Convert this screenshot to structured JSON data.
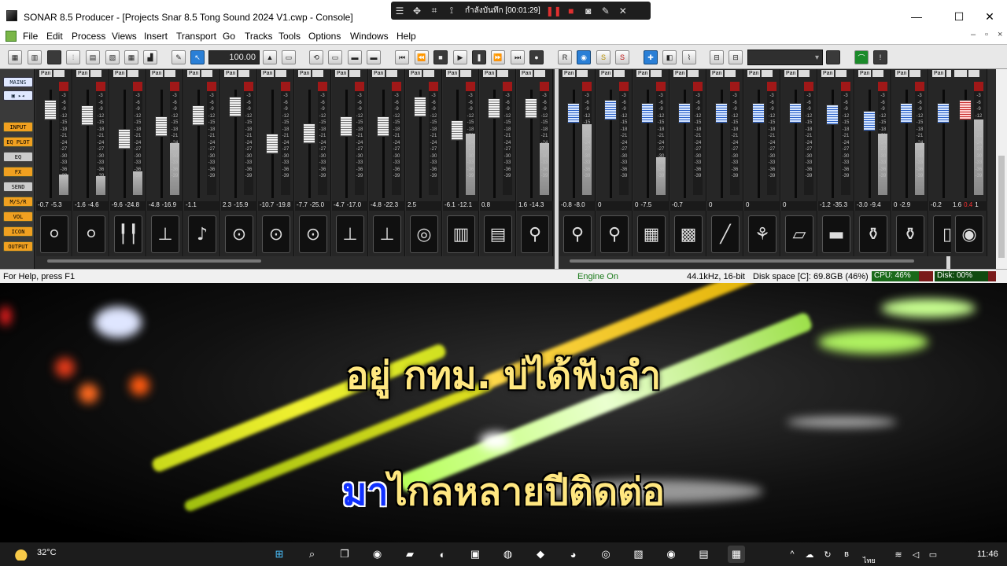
{
  "window": {
    "title": "SONAR 8.5 Producer - [Projects Snar 8.5 Tong Sound 2024 V1.cwp - Console]",
    "minimize": "—",
    "maximize": "☐",
    "close": "✕"
  },
  "recorder": {
    "status": "กำลังบันทึก [00:01:29]",
    "icons": [
      "menu-icon",
      "move-icon",
      "region-icon",
      "crop-icon",
      "pause-icon",
      "stop-icon",
      "camera-icon",
      "pen-icon",
      "close-icon"
    ]
  },
  "menu": {
    "items": [
      "File",
      "Edit",
      "Process",
      "Views",
      "Insert",
      "Transport",
      "Go",
      "Tracks",
      "Tools",
      "Options",
      "Windows",
      "Help"
    ],
    "doc_min": "–",
    "doc_restore": "▫",
    "doc_close": "×"
  },
  "toolbar": {
    "tempo": "100.00",
    "dropdown_arrow": "▾",
    "record_label": "R",
    "solo_label": "S",
    "mute_label": "S"
  },
  "left_panel": {
    "buttons": [
      "MAINS",
      "INPUT",
      "EQ PLOT",
      "EQ",
      "FX",
      "SEND",
      "M/S/R",
      "VOL",
      "ICON",
      "OUTPUT"
    ]
  },
  "strips": [
    {
      "pan": "Pan",
      "vals": [
        "-0.7",
        "-5.3"
      ],
      "icon": "⚪",
      "icon_name": "bass-drum-icon",
      "fader": 0.12,
      "level": 0.22,
      "color": "gray"
    },
    {
      "pan": "Pan",
      "vals": [
        "-1.6",
        "-4.6"
      ],
      "icon": "⚪",
      "icon_name": "drum-icon",
      "fader": 0.18,
      "level": 0.2,
      "color": "gray"
    },
    {
      "pan": "Pan",
      "vals": [
        "-9.6",
        "-24.8"
      ],
      "icon": "╿╿",
      "icon_name": "drumsticks-icon",
      "fader": 0.45,
      "level": 0.25,
      "color": "gray"
    },
    {
      "pan": "Pan",
      "vals": [
        "-4.8",
        "-16.9"
      ],
      "icon": "⊥",
      "icon_name": "hihat-icon",
      "fader": 0.3,
      "level": 0.55,
      "color": "gray"
    },
    {
      "pan": "Pan",
      "vals": [
        "-1.1",
        ""
      ],
      "icon": "♪",
      "icon_name": "microphone-icon",
      "fader": 0.18,
      "level": 0.0,
      "color": "gray"
    },
    {
      "pan": "Pan",
      "vals": [
        "2.3",
        "-15.9"
      ],
      "icon": "⊙",
      "icon_name": "snare-icon",
      "fader": 0.08,
      "level": 0.0,
      "color": "gray"
    },
    {
      "pan": "Pan",
      "vals": [
        "-10.7",
        "-19.8"
      ],
      "icon": "⊙",
      "icon_name": "snare-icon",
      "fader": 0.5,
      "level": 0.0,
      "color": "gray"
    },
    {
      "pan": "Pan",
      "vals": [
        "-7.7",
        "-25.0"
      ],
      "icon": "⊙",
      "icon_name": "snare-icon",
      "fader": 0.38,
      "level": 0.0,
      "color": "gray"
    },
    {
      "pan": "Pan",
      "vals": [
        "-4.7",
        "-17.0"
      ],
      "icon": "⊥",
      "icon_name": "cymbal-icon",
      "fader": 0.3,
      "level": 0.0,
      "color": "gray"
    },
    {
      "pan": "Pan",
      "vals": [
        "-4.8",
        "-22.3"
      ],
      "icon": "⊥",
      "icon_name": "cymbal-icon",
      "fader": 0.3,
      "level": 0.0,
      "color": "gray"
    },
    {
      "pan": "Pan",
      "vals": [
        "2.5",
        ""
      ],
      "icon": "◎",
      "icon_name": "gong-icon",
      "fader": 0.08,
      "level": 0.0,
      "color": "gray"
    },
    {
      "pan": "Pan",
      "vals": [
        "-6.1",
        "-12.1"
      ],
      "icon": "▥",
      "icon_name": "bongo-icon",
      "fader": 0.35,
      "level": 0.65,
      "color": "gray"
    },
    {
      "pan": "Pan",
      "vals": [
        "0.8",
        ""
      ],
      "icon": "▤",
      "icon_name": "accordion-icon",
      "fader": 0.1,
      "level": 0.0,
      "color": "gray"
    },
    {
      "pan": "Pan",
      "vals": [
        "1.6",
        "-14.3"
      ],
      "icon": "⚲",
      "icon_name": "guitar-icon",
      "fader": 0.1,
      "level": 0.55,
      "color": "gray"
    },
    {
      "pan": "Pan",
      "vals": [
        "-0.8",
        "-8.0"
      ],
      "icon": "⚲",
      "icon_name": "electric-guitar-icon",
      "fader": 0.15,
      "level": 0.75,
      "color": "blue"
    },
    {
      "pan": "Pan",
      "vals": [
        "0",
        ""
      ],
      "icon": "⚲",
      "icon_name": "bass-guitar-icon",
      "fader": 0.12,
      "level": 0.0,
      "color": "blue"
    },
    {
      "pan": "Pan",
      "vals": [
        "0",
        "-7.5"
      ],
      "icon": "▦",
      "icon_name": "keyboard-icon",
      "fader": 0.15,
      "level": 0.4,
      "color": "blue"
    },
    {
      "pan": "Pan",
      "vals": [
        "-0.7",
        ""
      ],
      "icon": "▩",
      "icon_name": "piano-player-icon",
      "fader": 0.15,
      "level": 0.0,
      "color": "blue"
    },
    {
      "pan": "Pan",
      "vals": [
        "0",
        ""
      ],
      "icon": "╱",
      "icon_name": "flute-icon",
      "fader": 0.15,
      "level": 0.0,
      "color": "blue"
    },
    {
      "pan": "Pan",
      "vals": [
        "0",
        ""
      ],
      "icon": "⚘",
      "icon_name": "banjo-icon",
      "fader": 0.15,
      "level": 0.0,
      "color": "blue"
    },
    {
      "pan": "Pan",
      "vals": [
        "0",
        ""
      ],
      "icon": "▱",
      "icon_name": "grand-piano-icon",
      "fader": 0.15,
      "level": 0.0,
      "color": "blue"
    },
    {
      "pan": "Pan",
      "vals": [
        "-1.2",
        "-35.3"
      ],
      "icon": "▬",
      "icon_name": "synth-icon",
      "fader": 0.17,
      "level": 0.0,
      "color": "blue"
    },
    {
      "pan": "Pan",
      "vals": [
        "-3.0",
        "-9.4"
      ],
      "icon": "⚱",
      "icon_name": "drum-kit-icon",
      "fader": 0.24,
      "level": 0.65,
      "color": "blue"
    },
    {
      "pan": "Pan",
      "vals": [
        "0",
        "-2.9"
      ],
      "icon": "⚱",
      "icon_name": "drum-kit-icon",
      "fader": 0.15,
      "level": 0.55,
      "color": "blue"
    },
    {
      "pan": "Pan",
      "vals": [
        "-0.2",
        ""
      ],
      "icon": "▯",
      "icon_name": "instrument-icon",
      "fader": 0.15,
      "level": 0.0,
      "color": "blue"
    }
  ],
  "master": {
    "vals": [
      "1.6",
      "0.4",
      "1"
    ],
    "icon": "◉",
    "icon_name": "speaker-icon",
    "fader": 0.12,
    "level": 0.8
  },
  "status": {
    "help": "For Help, press F1",
    "engine": "Engine On",
    "format": "44.1kHz, 16-bit",
    "disk_space": "Disk space [C]: 69.8GB (46%)",
    "cpu": "CPU: 46%",
    "disk": "Disk: 00%"
  },
  "lyrics": {
    "line1": "อยู่ กทม. บ่ได้ฟังลำ",
    "line2_sung": "มา",
    "line2_rest": "ไกลหลายปีติดต่อ"
  },
  "taskbar": {
    "temp": "32°C",
    "time": "11:46",
    "lang": "ไทย",
    "apps": [
      {
        "name": "start-icon",
        "glyph": "⊞"
      },
      {
        "name": "search-icon",
        "glyph": "⌕"
      },
      {
        "name": "taskview-icon",
        "glyph": "❐"
      },
      {
        "name": "chat-icon",
        "glyph": "◉"
      },
      {
        "name": "explorer-icon",
        "glyph": "▰"
      },
      {
        "name": "edge-icon",
        "glyph": "◐"
      },
      {
        "name": "store-icon",
        "glyph": "▣"
      },
      {
        "name": "chrome-icon",
        "glyph": "◍"
      },
      {
        "name": "brave-icon",
        "glyph": "◆"
      },
      {
        "name": "firefox-icon",
        "glyph": "◕"
      },
      {
        "name": "spotify-icon",
        "glyph": "◎"
      },
      {
        "name": "photos-icon",
        "glyph": "▧"
      },
      {
        "name": "recorder-icon",
        "glyph": "◉"
      },
      {
        "name": "app-icon",
        "glyph": "▤"
      },
      {
        "name": "sonar-icon",
        "glyph": "▦"
      }
    ],
    "tray": [
      {
        "name": "tray-chevron-icon",
        "glyph": "^"
      },
      {
        "name": "cloud-icon",
        "glyph": "☁"
      },
      {
        "name": "sync-icon",
        "glyph": "↻"
      },
      {
        "name": "bluetooth-icon",
        "glyph": "ʙ"
      },
      {
        "name": "wifi-icon",
        "glyph": "≋"
      },
      {
        "name": "volume-icon",
        "glyph": "◁"
      },
      {
        "name": "battery-icon",
        "glyph": "▭"
      }
    ]
  }
}
